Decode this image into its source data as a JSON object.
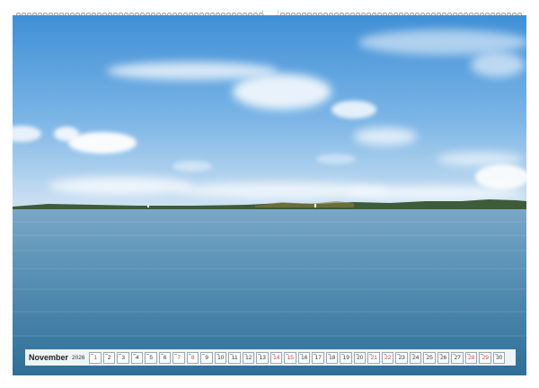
{
  "calendar": {
    "month": "November",
    "year": "2026",
    "days": [
      {
        "n": "1",
        "sunday": true
      },
      {
        "n": "2",
        "sunday": false
      },
      {
        "n": "3",
        "sunday": false
      },
      {
        "n": "4",
        "sunday": false
      },
      {
        "n": "5",
        "sunday": false
      },
      {
        "n": "6",
        "sunday": false
      },
      {
        "n": "7",
        "sunday": true
      },
      {
        "n": "8",
        "sunday": true
      },
      {
        "n": "9",
        "sunday": false
      },
      {
        "n": "10",
        "sunday": false
      },
      {
        "n": "11",
        "sunday": false
      },
      {
        "n": "12",
        "sunday": false
      },
      {
        "n": "13",
        "sunday": false
      },
      {
        "n": "14",
        "sunday": true
      },
      {
        "n": "15",
        "sunday": true
      },
      {
        "n": "16",
        "sunday": false
      },
      {
        "n": "17",
        "sunday": false
      },
      {
        "n": "18",
        "sunday": false
      },
      {
        "n": "19",
        "sunday": false
      },
      {
        "n": "20",
        "sunday": false
      },
      {
        "n": "21",
        "sunday": true
      },
      {
        "n": "22",
        "sunday": true
      },
      {
        "n": "23",
        "sunday": false
      },
      {
        "n": "24",
        "sunday": false
      },
      {
        "n": "25",
        "sunday": false
      },
      {
        "n": "26",
        "sunday": false
      },
      {
        "n": "27",
        "sunday": false
      },
      {
        "n": "28",
        "sunday": true
      },
      {
        "n": "29",
        "sunday": true
      },
      {
        "n": "30",
        "sunday": false
      }
    ]
  },
  "colors": {
    "sky_top": "#3f8fd6",
    "sky_bottom": "#cfe3f3",
    "water_top": "#6d9fbf",
    "water_bottom": "#2f6f97",
    "sunday": "#d23b3b"
  }
}
